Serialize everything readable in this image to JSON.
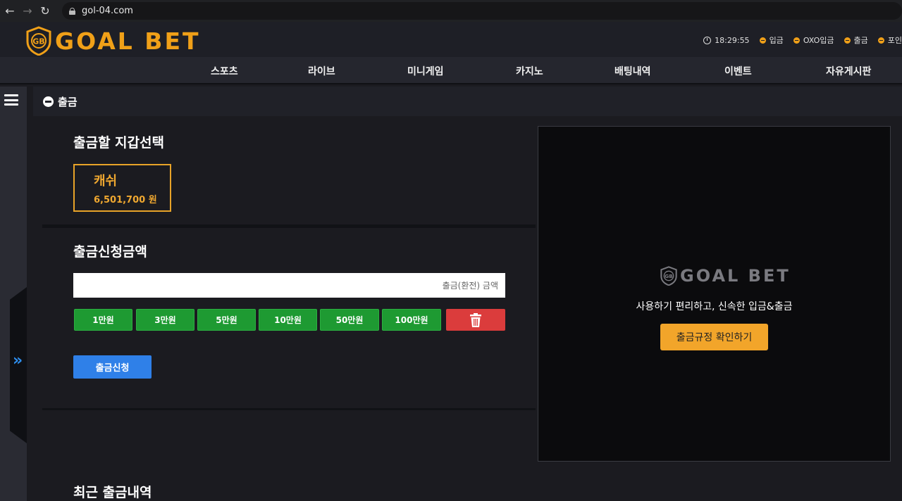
{
  "browser": {
    "url": "gol-04.com"
  },
  "header": {
    "logo_text": "GOAL BET",
    "time": "18:29:55",
    "links": [
      "입금",
      "OXO입금",
      "출금",
      "포인"
    ]
  },
  "nav": {
    "items": [
      "스포츠",
      "라이브",
      "미니게임",
      "카지노",
      "배팅내역",
      "이벤트",
      "자유게시판"
    ]
  },
  "page": {
    "title": "출금"
  },
  "wallet": {
    "heading": "출금할 지갑선택",
    "name": "캐쉬",
    "amount": "6,501,700 원"
  },
  "withdraw": {
    "heading": "출금신청금액",
    "input_placeholder": "출금(환전) 금액",
    "amount_buttons": [
      "1만원",
      "3만원",
      "5만원",
      "10만원",
      "50만원",
      "100만원"
    ],
    "submit_label": "출금신청"
  },
  "history": {
    "heading": "최근 출금내역"
  },
  "promo": {
    "logo_text": "GOAL BET",
    "description": "사용하기 편리하고, 신속한 입금&출금",
    "button_label": "출금규정 확인하기"
  },
  "colors": {
    "accent": "#f0a018",
    "green": "#1e9a32",
    "red": "#db3c3c",
    "blue": "#2f80e8"
  }
}
